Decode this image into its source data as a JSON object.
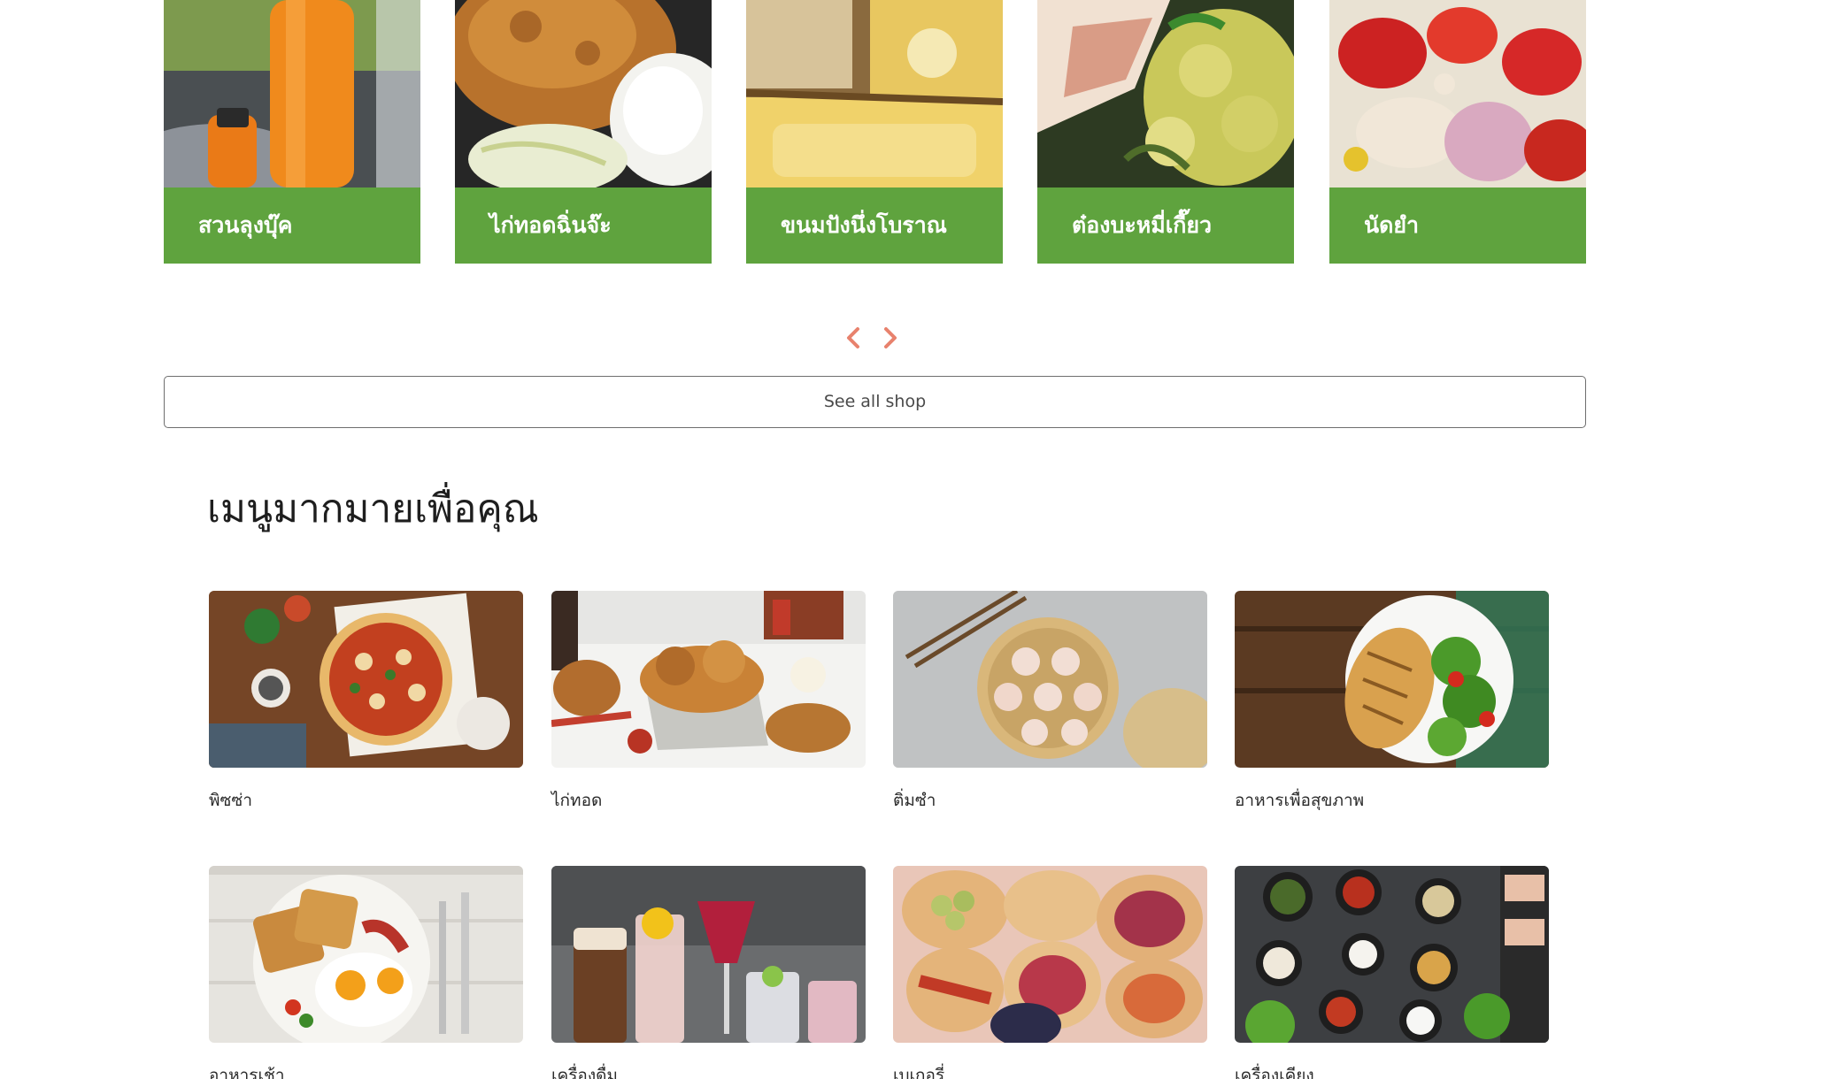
{
  "shops": [
    {
      "name": "สวนลุงบุ๊ค",
      "icon": "orange-juice-bottle-photo"
    },
    {
      "name": "ไก่ทอดฉิ่นจ๊ะ",
      "icon": "fried-chicken-rice-photo"
    },
    {
      "name": "ขนมปังนึ่งโบราณ",
      "icon": "steamed-bread-photo"
    },
    {
      "name": "ต๋องบะหมี่เกี๊ยว",
      "icon": "wonton-noodle-photo"
    },
    {
      "name": "นัดยำ",
      "icon": "spicy-salad-photo"
    }
  ],
  "carousel": {
    "prev_icon": "chevron-left-icon",
    "next_icon": "chevron-right-icon",
    "arrow_color": "#e8826d"
  },
  "see_all_label": "See all shop",
  "menu": {
    "title": "เมนูมากมายเพื่อคุณ",
    "items": [
      {
        "label": "พิซซ่า",
        "icon": "pizza-photo"
      },
      {
        "label": "ไก่ทอด",
        "icon": "fried-chicken-photo"
      },
      {
        "label": "ติ่มซำ",
        "icon": "dim-sum-photo"
      },
      {
        "label": "อาหารเพื่อสุขภาพ",
        "icon": "healthy-food-photo"
      },
      {
        "label": "อาหารเช้า",
        "icon": "breakfast-photo"
      },
      {
        "label": "เครื่องดื่ม",
        "icon": "drinks-photo"
      },
      {
        "label": "เบเกอรี่",
        "icon": "bakery-photo"
      },
      {
        "label": "เครื่องเคียง",
        "icon": "side-dishes-photo"
      }
    ]
  },
  "colors": {
    "brand_green": "#5fa33e",
    "card_background": "#fff8f8",
    "border": "#6e6e6e"
  }
}
